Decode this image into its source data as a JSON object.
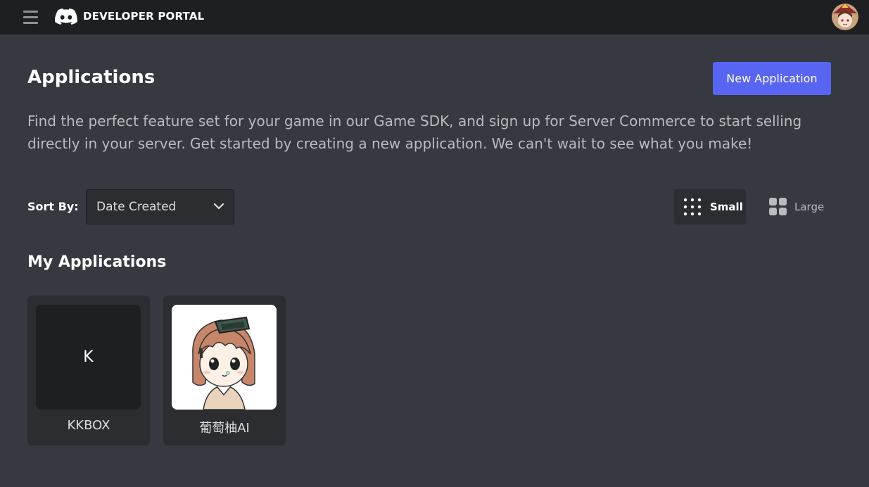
{
  "header": {
    "title": "DEVELOPER PORTAL",
    "menu_icon": "hamburger-menu-icon",
    "logo_icon": "discord-logo-icon",
    "avatar_icon": "user-avatar-icon"
  },
  "page": {
    "title": "Applications",
    "new_button_label": "New Application",
    "description": "Find the perfect feature set for your game in our Game SDK, and sign up for Server Commerce to start selling directly in your server. Get started by creating a new application. We can't wait to see what you make!"
  },
  "sort": {
    "label": "Sort By:",
    "selected": "Date Created"
  },
  "view_toggle": {
    "small_label": "Small",
    "large_label": "Large",
    "active": "Small"
  },
  "section": {
    "title": "My Applications"
  },
  "apps": [
    {
      "name": "KKBOX",
      "initial": "K",
      "icon": "placeholder-initial"
    },
    {
      "name": "葡萄柚AI",
      "icon": "anime-character-avatar"
    }
  ],
  "colors": {
    "background": "#36393f",
    "topbar": "#1e1f22",
    "card": "#2b2d31",
    "accent": "#5865f2",
    "muted_text": "#b9bbbe"
  }
}
